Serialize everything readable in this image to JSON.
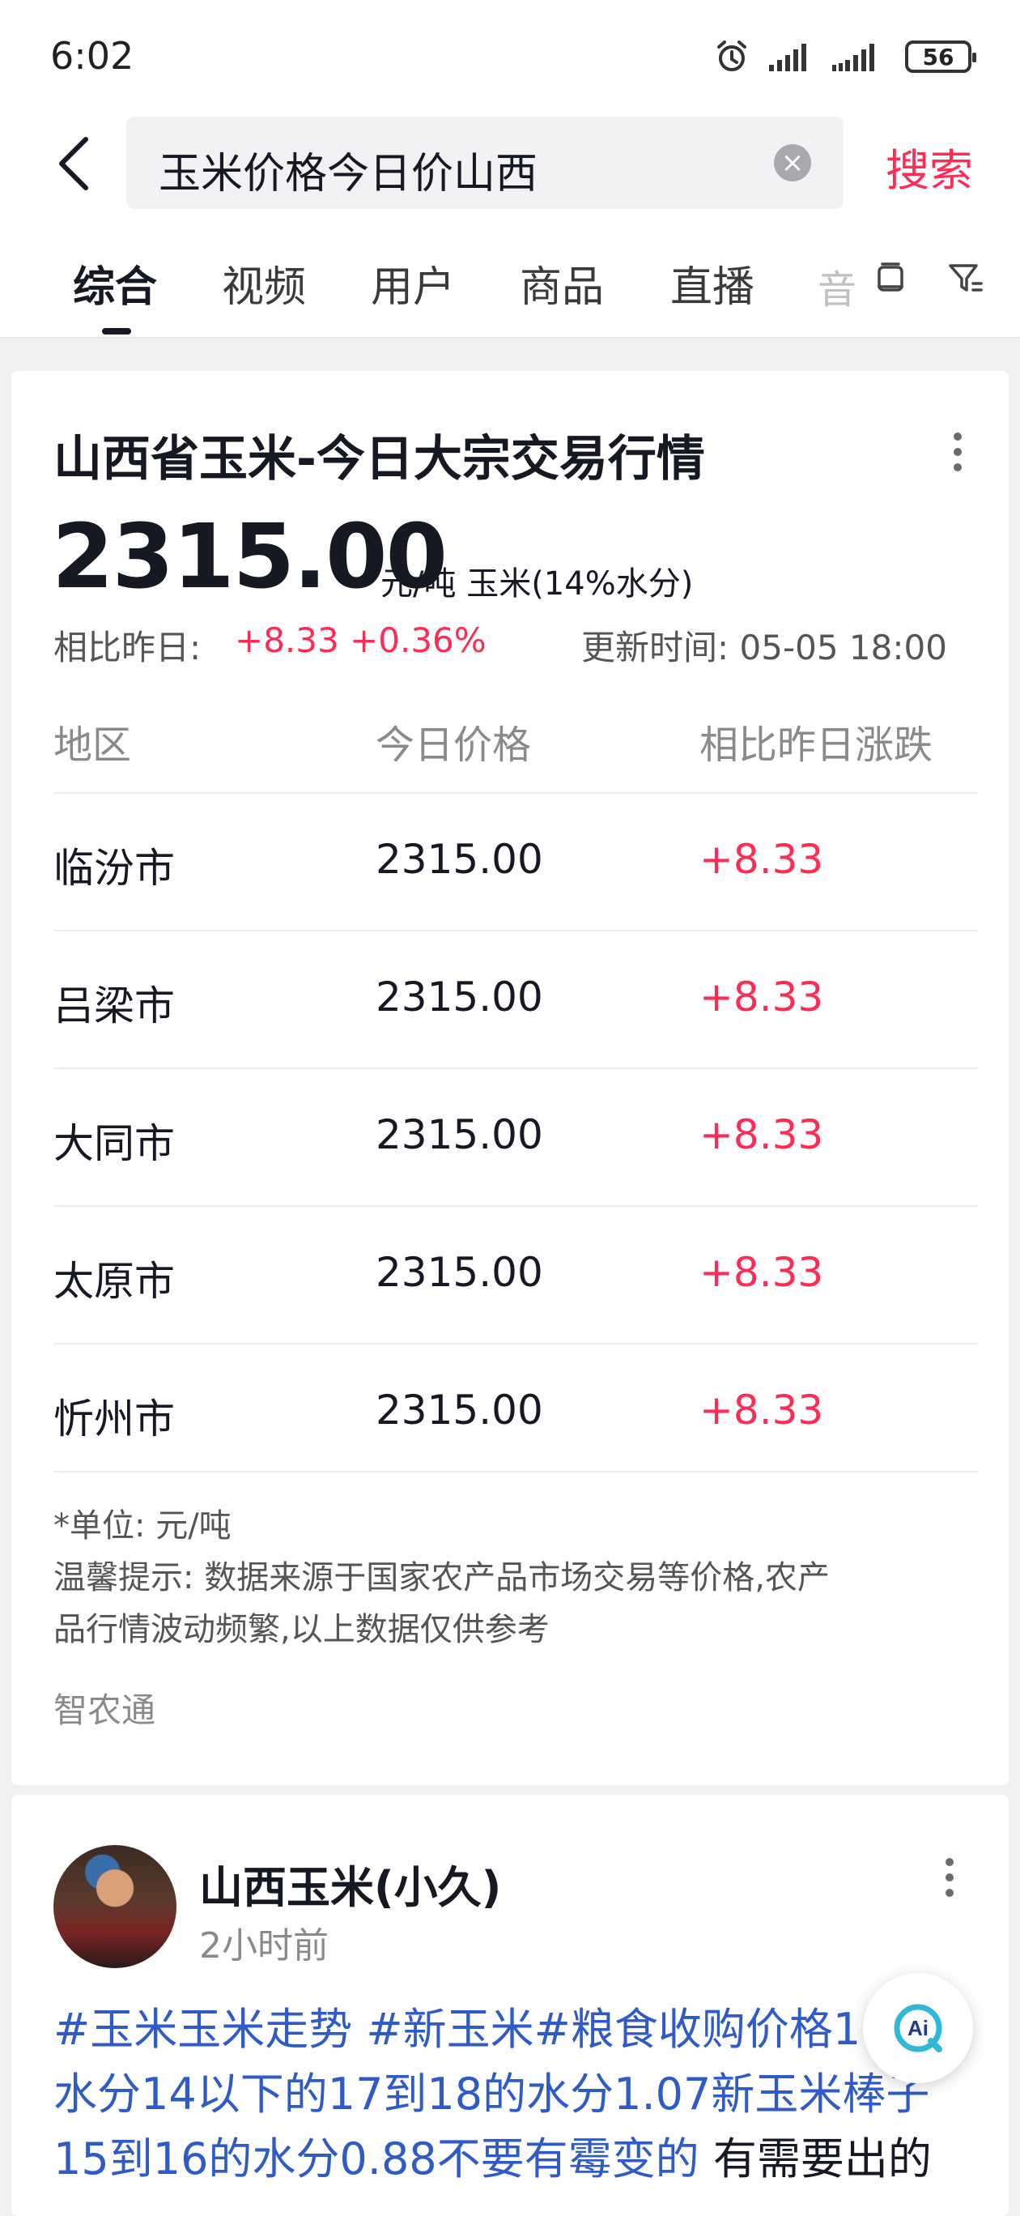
{
  "status_bar": {
    "time": "6:02",
    "battery": "56"
  },
  "search": {
    "query": "玉米价格今日价山西",
    "button_label": "搜索"
  },
  "tabs": [
    {
      "label": "综合",
      "active": true
    },
    {
      "label": "视频"
    },
    {
      "label": "用户"
    },
    {
      "label": "商品"
    },
    {
      "label": "直播"
    },
    {
      "label": "音"
    }
  ],
  "market_card": {
    "title": "山西省玉米-今日大宗交易行情",
    "price": "2315.00",
    "unit": "元/吨 玉米(14%水分)",
    "compare_label": "相比昨日:",
    "compare_value": "+8.33 +0.36%",
    "updated": "更新时间: 05-05 18:00",
    "headers": [
      "地区",
      "今日价格",
      "相比昨日涨跌"
    ],
    "rows": [
      {
        "region": "临汾市",
        "price": "2315.00",
        "change": "+8.33"
      },
      {
        "region": "吕梁市",
        "price": "2315.00",
        "change": "+8.33"
      },
      {
        "region": "大同市",
        "price": "2315.00",
        "change": "+8.33"
      },
      {
        "region": "太原市",
        "price": "2315.00",
        "change": "+8.33"
      },
      {
        "region": "忻州市",
        "price": "2315.00",
        "change": "+8.33"
      }
    ],
    "unit_note": "*单位: 元/吨",
    "tip_line1": "温馨提示: 数据来源于国家农产品市场交易等价格,农产",
    "tip_line2": "品行情波动频繁,以上数据仅供参考",
    "source": "智农通"
  },
  "post": {
    "username": "山西玉米(小久)",
    "time": "2小时前",
    "line1_tag": "#玉米玉米走势 #新玉米#粮食收购价格1",
    "line2_tag": "水分14以下的17到18的水分1.07新玉米棒子",
    "line3_tag": "15到16的水分0.88不要有霉变的",
    "line3_text": " 有需要出的"
  },
  "colors": {
    "accent": "#fe2c55",
    "hashtag": "#2f5bc9",
    "text": "#161823"
  },
  "icons": [
    "back-arrow-icon",
    "clear-icon",
    "layout-icon",
    "filter-icon",
    "more-vertical-icon",
    "ai-assistant-icon",
    "alarm-icon",
    "signal-icon"
  ]
}
